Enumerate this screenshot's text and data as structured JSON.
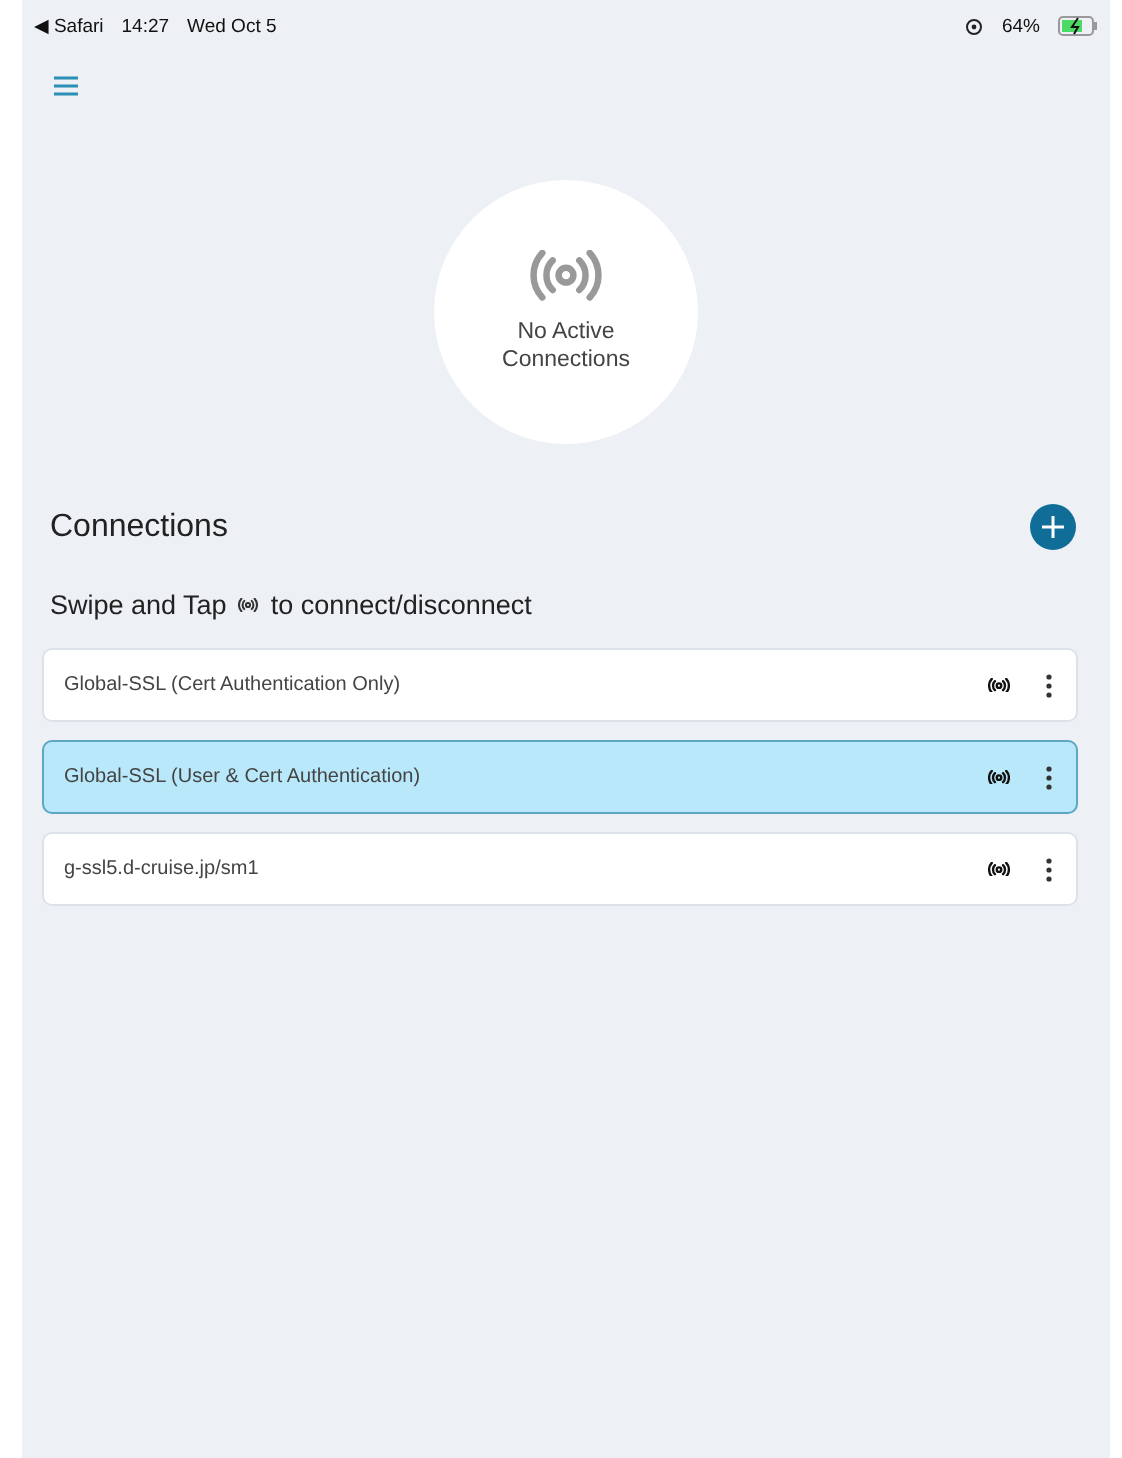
{
  "status_bar": {
    "back": "◀ Safari",
    "time": "14:27",
    "date": "Wed Oct 5",
    "battery": "64%"
  },
  "summary": {
    "text": "No Active Connections"
  },
  "connections": {
    "title": "Connections",
    "hint_before": "Swipe and Tap",
    "hint_after": "to connect/disconnect",
    "items": [
      {
        "name": "Global-SSL (Cert Authentication Only)",
        "selected": false
      },
      {
        "name": "Global-SSL (User & Cert Authentication)",
        "selected": true
      },
      {
        "name": "g-ssl5.d-cruise.jp/sm1",
        "selected": false
      }
    ]
  }
}
